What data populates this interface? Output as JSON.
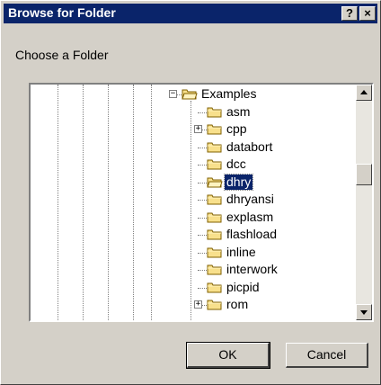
{
  "window": {
    "title": "Browse for Folder",
    "help_label": "?",
    "close_label": "×"
  },
  "prompt": "Choose a Folder",
  "tree": {
    "parent": {
      "label": "Examples",
      "expanded": true
    },
    "items": [
      {
        "label": "asm",
        "expandable": false,
        "selected": false
      },
      {
        "label": "cpp",
        "expandable": true,
        "selected": false
      },
      {
        "label": "databort",
        "expandable": false,
        "selected": false
      },
      {
        "label": "dcc",
        "expandable": false,
        "selected": false
      },
      {
        "label": "dhry",
        "expandable": false,
        "selected": true
      },
      {
        "label": "dhryansi",
        "expandable": false,
        "selected": false
      },
      {
        "label": "explasm",
        "expandable": false,
        "selected": false
      },
      {
        "label": "flashload",
        "expandable": false,
        "selected": false
      },
      {
        "label": "inline",
        "expandable": false,
        "selected": false
      },
      {
        "label": "interwork",
        "expandable": false,
        "selected": false
      },
      {
        "label": "picpid",
        "expandable": false,
        "selected": false
      },
      {
        "label": "rom",
        "expandable": true,
        "selected": false
      }
    ]
  },
  "buttons": {
    "ok": "OK",
    "cancel": "Cancel"
  },
  "colors": {
    "titlebar": "#0a246a",
    "selection": "#0a246a",
    "dialog_face": "#d4d0c8",
    "folder_fill": "#f8e08c"
  }
}
